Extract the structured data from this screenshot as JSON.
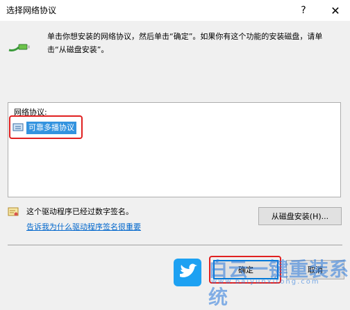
{
  "window": {
    "title": "选择网络协议",
    "help_glyph": "?",
    "close_glyph": "✕"
  },
  "instruction": "单击你想安装的网络协议，然后单击“确定”。如果你有这个功能的安装磁盘，请单击“从磁盘安装”。",
  "protocol_list": {
    "header": "网络协议:",
    "items": [
      {
        "label": "可靠多播协议",
        "selected": true
      }
    ]
  },
  "signature": {
    "status": "这个驱动程序已经过数字签名。",
    "link": "告诉我为什么驱动程序签名很重要"
  },
  "buttons": {
    "from_disk": "从磁盘安装(H)...",
    "ok": "确定",
    "cancel": "取消"
  },
  "watermark": {
    "text": "白云一键重装系统",
    "url": "www.baiyunxitong.com"
  },
  "colors": {
    "selection": "#3393df",
    "highlight": "#e02020",
    "link": "#0066cc",
    "focus": "#0078d7"
  }
}
